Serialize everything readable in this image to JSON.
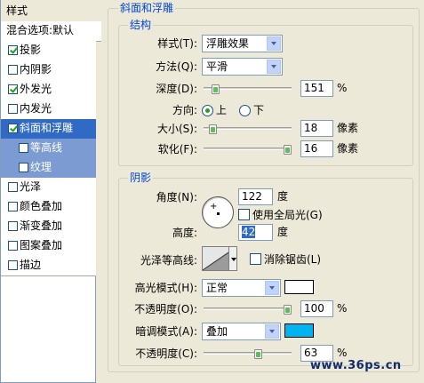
{
  "style_list": {
    "header": "样式",
    "blending": "混合选项:默认",
    "items": [
      {
        "label": "投影",
        "checked": true,
        "state": "normal"
      },
      {
        "label": "内阴影",
        "checked": false,
        "state": "normal"
      },
      {
        "label": "外发光",
        "checked": true,
        "state": "normal"
      },
      {
        "label": "内发光",
        "checked": false,
        "state": "normal"
      },
      {
        "label": "斜面和浮雕",
        "checked": true,
        "state": "selected"
      },
      {
        "label": "等高线",
        "checked": false,
        "state": "sub"
      },
      {
        "label": "纹理",
        "checked": false,
        "state": "sub"
      },
      {
        "label": "光泽",
        "checked": false,
        "state": "normal"
      },
      {
        "label": "颜色叠加",
        "checked": false,
        "state": "normal"
      },
      {
        "label": "渐变叠加",
        "checked": false,
        "state": "normal"
      },
      {
        "label": "图案叠加",
        "checked": false,
        "state": "normal"
      },
      {
        "label": "描边",
        "checked": false,
        "state": "normal"
      }
    ]
  },
  "bevel": {
    "title": "斜面和浮雕",
    "structure": {
      "title": "结构",
      "style_label": "样式(T):",
      "style_value": "浮雕效果",
      "technique_label": "方法(Q):",
      "technique_value": "平滑",
      "depth_label": "深度(D):",
      "depth_value": "151",
      "depth_unit": "%",
      "depth_slider": 0.1,
      "direction_label": "方向:",
      "direction_up": "上",
      "direction_down": "下",
      "direction_selected": "up",
      "size_label": "大小(S):",
      "size_value": "18",
      "size_unit": "像素",
      "size_slider": 0.07,
      "soften_label": "软化(F):",
      "soften_value": "16",
      "soften_unit": "像素",
      "soften_slider": 1.0
    },
    "shading": {
      "title": "阴影",
      "angle_label": "角度(N):",
      "angle_value": "122",
      "angle_unit": "度",
      "global_light_label": "使用全局光(G)",
      "global_light_checked": false,
      "altitude_label": "高度:",
      "altitude_value": "42",
      "altitude_unit": "度",
      "gloss_contour_label": "光泽等高线:",
      "anti_aliased_label": "消除锯齿(L)",
      "anti_aliased_checked": false,
      "highlight_mode_label": "高光模式(H):",
      "highlight_mode_value": "正常",
      "highlight_color": "#ffffff",
      "highlight_opacity_label": "不透明度(O):",
      "highlight_opacity_value": "100",
      "highlight_opacity_unit": "%",
      "highlight_opacity_slider": 1.0,
      "shadow_mode_label": "暗调模式(A):",
      "shadow_mode_value": "叠加",
      "shadow_color": "#00b4f0",
      "shadow_opacity_label": "不透明度(C):",
      "shadow_opacity_value": "63",
      "shadow_opacity_unit": "%",
      "shadow_opacity_slider": 0.63
    }
  },
  "watermark": "www.36ps.cn",
  "colors": {
    "selected": "#316ac5",
    "sub": "#7b9bd2",
    "panel_bg": "#ece9d8"
  }
}
